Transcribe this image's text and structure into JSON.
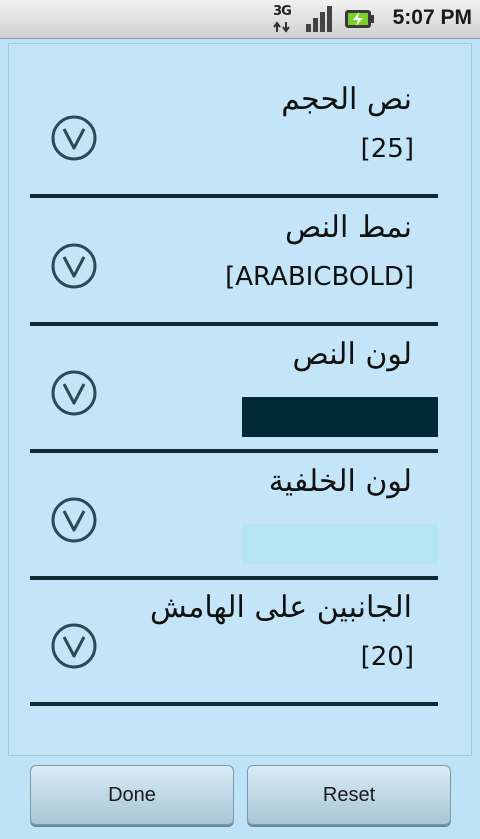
{
  "status_bar": {
    "network_label": "3G",
    "time": "5:07 PM",
    "icons": [
      "3g-data-icon",
      "signal-strength-icon",
      "battery-charging-icon"
    ]
  },
  "settings": [
    {
      "title": "نص الحجم",
      "value": "[25]"
    },
    {
      "title": "نمط النص",
      "value": "[ARABICBOLD]"
    },
    {
      "title": "لون النص",
      "swatch_color": "#002b36"
    },
    {
      "title": "لون الخلفية",
      "swatch_color": "#b3e5f3"
    },
    {
      "title": "الجانبين على الهامش",
      "value": "[20]"
    }
  ],
  "buttons": {
    "done": "Done",
    "reset": "Reset"
  },
  "colors": {
    "dialog_bg": "#bfe3f6",
    "divider": "#0f2a33",
    "check_ring": "#2b4a55"
  }
}
